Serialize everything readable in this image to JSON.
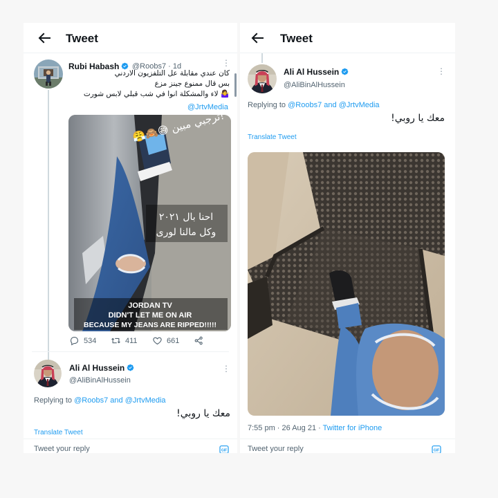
{
  "left": {
    "header": {
      "title": "Tweet"
    },
    "tweet": {
      "author_name": "Rubi Habash",
      "handle": "@Roobs7",
      "separator": "·",
      "time": "1d",
      "text_lines": [
        "كان عندي مقابلة عل التلفزيون الاردني",
        "بس قال ممنوع جينز مزع",
        "🤷‍♀️ لاء والمشكلة انوا في شب قبلي لابس شورت"
      ],
      "mention": "@JrtvMedia",
      "image_overlays": {
        "top": "😤🙈😅 ترجبي مبين!",
        "middle_line1": "احنا بال ٢٠٢١",
        "middle_line2": "وكل مالنا لورى",
        "bottom_line1": "JORDAN TV",
        "bottom_line2": "DIDN'T LET ME ON AIR",
        "bottom_line3": "BECAUSE MY JEANS ARE RIPPED!!!!!"
      },
      "stats": {
        "replies": "534",
        "retweets": "411",
        "likes": "661"
      }
    },
    "reply": {
      "author_name": "Ali Al Hussein",
      "handle": "@AliBinAlHussein",
      "replying_prefix": "Replying to",
      "replying_to_1": "@Roobs7",
      "replying_and": "and",
      "replying_to_2": "@JrtvMedia",
      "text": "معك يا روبي!",
      "translate": "Translate Tweet"
    },
    "reply_bar": {
      "placeholder": "Tweet your reply"
    }
  },
  "right": {
    "header": {
      "title": "Tweet"
    },
    "tweet": {
      "author_name": "Ali Al Hussein",
      "handle": "@AliBinAlHussein",
      "replying_prefix": "Replying to",
      "replying_to_1": "@Roobs7",
      "replying_and": "and",
      "replying_to_2": "@JrtvMedia",
      "text": "معك يا روبي!",
      "translate": "Translate Tweet",
      "timestamp": "7:55 pm · 26 Aug 21 ·",
      "source": "Twitter for iPhone"
    },
    "reply_bar": {
      "placeholder": "Tweet your reply"
    }
  },
  "icons": [
    "back-arrow-icon",
    "verified-badge-icon",
    "more-icon",
    "reply-icon",
    "retweet-icon",
    "like-icon",
    "share-icon",
    "gif-icon"
  ],
  "colors": {
    "link": "#1d9bf0",
    "verified": "#1d9bf0",
    "text": "#0f1419",
    "secondary": "#536471"
  }
}
